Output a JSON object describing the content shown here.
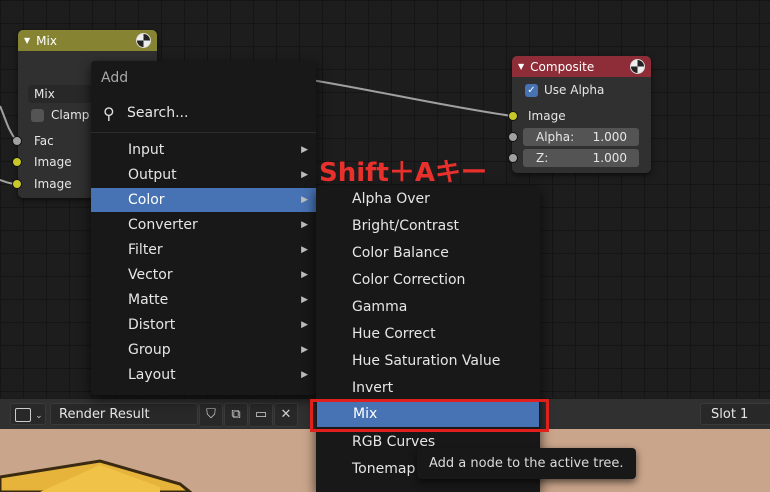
{
  "mix_node": {
    "title": "Mix",
    "blend_mode": "Mix",
    "clamp_label": "Clamp",
    "inputs": [
      "Fac",
      "Image",
      "Image"
    ]
  },
  "composite_node": {
    "title": "Composite",
    "use_alpha_label": "Use Alpha",
    "image_label": "Image",
    "alpha": {
      "label": "Alpha:",
      "value": "1.000"
    },
    "z": {
      "label": "Z:",
      "value": "1.000"
    }
  },
  "add_menu": {
    "title": "Add",
    "search_label": "Search...",
    "items": [
      {
        "label": "Input"
      },
      {
        "label": "Output"
      },
      {
        "label": "Color"
      },
      {
        "label": "Converter"
      },
      {
        "label": "Filter"
      },
      {
        "label": "Vector"
      },
      {
        "label": "Matte"
      },
      {
        "label": "Distort"
      },
      {
        "label": "Group"
      },
      {
        "label": "Layout"
      }
    ],
    "active_item": "Color"
  },
  "color_submenu": {
    "items": [
      {
        "label": "Alpha Over"
      },
      {
        "label": "Bright/Contrast"
      },
      {
        "label": "Color Balance"
      },
      {
        "label": "Color Correction"
      },
      {
        "label": "Gamma"
      },
      {
        "label": "Hue Correct"
      },
      {
        "label": "Hue Saturation Value"
      },
      {
        "label": "Invert"
      },
      {
        "label": "Mix"
      },
      {
        "label": "RGB Curves"
      },
      {
        "label": "Tonemap"
      }
    ],
    "active_item": "Mix"
  },
  "annotation": "Shift＋Aキー",
  "tooltip": "Add a node to the active tree.",
  "image_editor_header": {
    "image_name": "Render Result",
    "slot": "Slot 1"
  },
  "colors": {
    "accent": "#4772b3",
    "mix_header": "#868432",
    "composite_header": "#8e2d38",
    "annotation_red": "#e8302c"
  }
}
